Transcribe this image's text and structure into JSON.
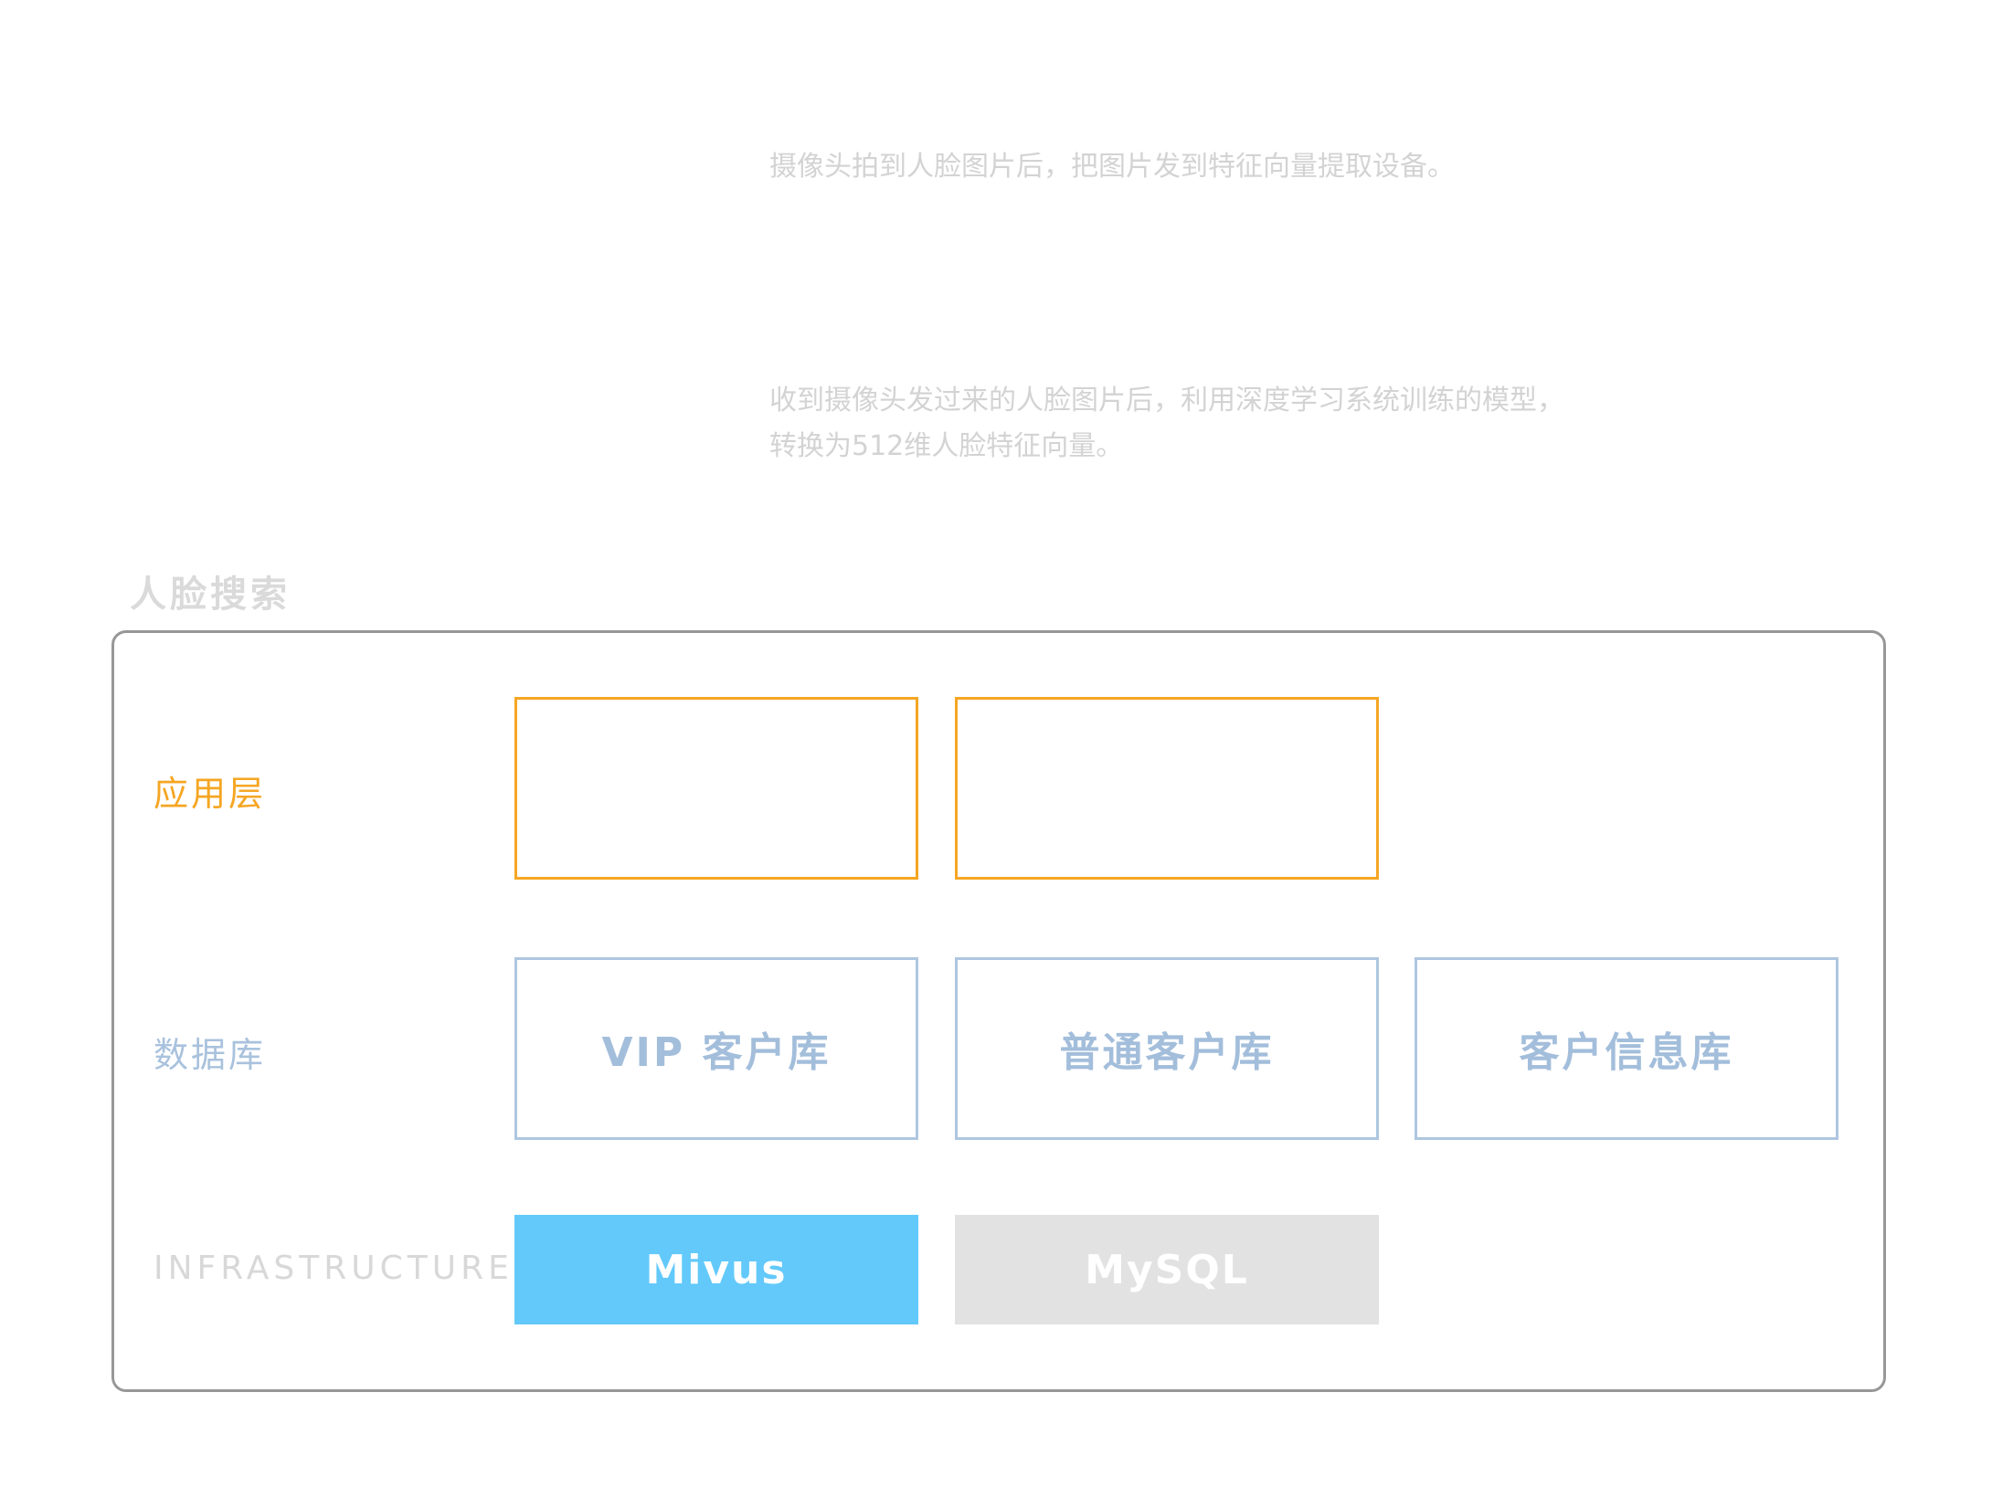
{
  "descriptions": {
    "step1": "摄像头拍到人脸图片后，把图片发到特征向量提取设备。",
    "step2": "收到摄像头发过来的人脸图片后，利用深度学习系统训练的模型，\n转换为512维人脸特征向量。"
  },
  "section": {
    "title": "人脸搜索"
  },
  "layers": {
    "application": {
      "label": "应用层",
      "boxes": [
        "",
        ""
      ]
    },
    "database": {
      "label": "数据库",
      "boxes": [
        "VIP 客户库",
        "普通客户库",
        "客户信息库"
      ]
    },
    "infrastructure": {
      "label": "INFRASTRUCTURE",
      "boxes": [
        "Mivus",
        "MySQL"
      ]
    }
  },
  "colors": {
    "application_accent": "#f5a623",
    "database_accent": "#a9c2dd",
    "mivus_fill": "#62c9fa",
    "mysql_fill": "#e2e2e2",
    "frame_border": "#979797",
    "muted_text": "#d3d3d3"
  }
}
